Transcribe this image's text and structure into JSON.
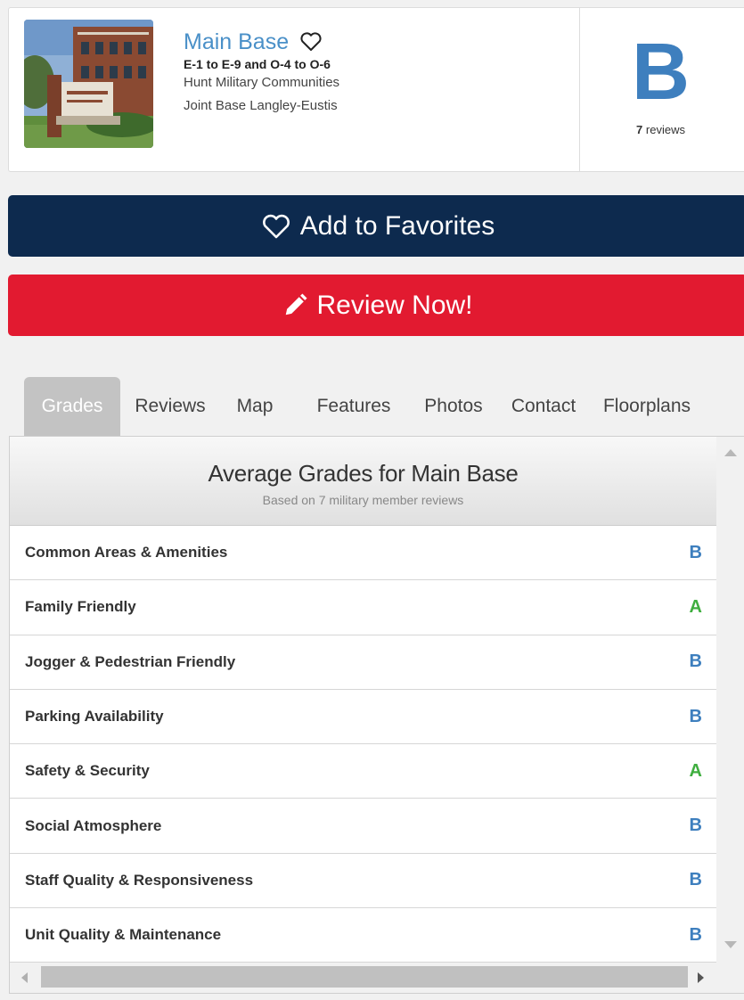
{
  "community": {
    "name": "Main Base",
    "ranks": "E-1 to E-9 and O-4 to O-6",
    "company": "Hunt Military Communities",
    "base": "Joint Base Langley-Eustis",
    "overall_grade": "B",
    "review_count": "7",
    "review_word": "reviews",
    "icons": {
      "favorite": "heart-outline-icon",
      "photo": "community-photo"
    }
  },
  "buttons": {
    "add_favorites": "Add to Favorites",
    "review_now": "Review Now!",
    "icons": {
      "add_favorites": "heart-outline-icon",
      "review_now": "pencil-icon"
    }
  },
  "tabs": [
    {
      "label": "Grades",
      "active": true
    },
    {
      "label": "Reviews",
      "active": false
    },
    {
      "label": "Map",
      "active": false
    },
    {
      "label": "Features",
      "active": false
    },
    {
      "label": "Photos",
      "active": false
    },
    {
      "label": "Contact",
      "active": false
    },
    {
      "label": "Floorplans",
      "active": false
    }
  ],
  "grades_panel": {
    "title": "Average Grades for Main Base",
    "subtitle": "Based on 7 military member reviews",
    "rows": [
      {
        "label": "Common Areas & Amenities",
        "grade": "B"
      },
      {
        "label": "Family Friendly",
        "grade": "A"
      },
      {
        "label": "Jogger & Pedestrian Friendly",
        "grade": "B"
      },
      {
        "label": "Parking Availability",
        "grade": "B"
      },
      {
        "label": "Safety & Security",
        "grade": "A"
      },
      {
        "label": "Social Atmosphere",
        "grade": "B"
      },
      {
        "label": "Staff Quality & Responsiveness",
        "grade": "B"
      },
      {
        "label": "Unit Quality & Maintenance",
        "grade": "B"
      }
    ]
  },
  "colors": {
    "grade_A": "#3fae3f",
    "grade_B": "#3e7fbe",
    "favorites_button": "#0d2a4e",
    "review_button": "#e21a30",
    "name_link": "#4a90c8"
  }
}
